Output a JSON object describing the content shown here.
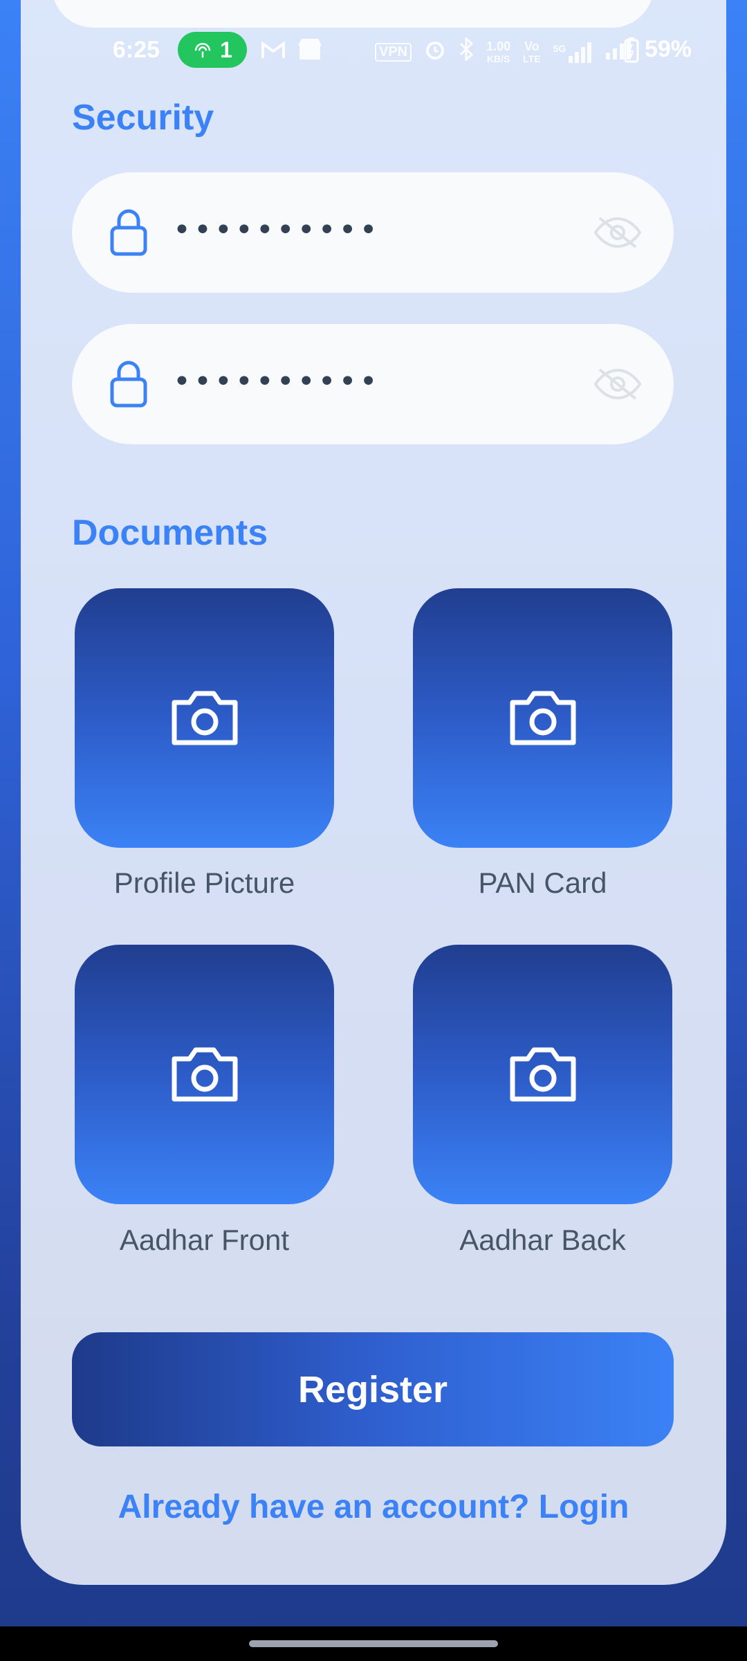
{
  "status_bar": {
    "time": "6:25",
    "hotspot_count": "1",
    "vpn": "VPN",
    "speed_value": "1.00",
    "speed_unit": "KB/S",
    "volte_top": "Vo",
    "volte_bottom": "LTE",
    "network": "5G",
    "battery": "59%"
  },
  "security": {
    "title": "Security",
    "password_value": "••••••••••",
    "confirm_password_value": "••••••••••"
  },
  "documents": {
    "title": "Documents",
    "items": [
      {
        "label": "Profile Picture"
      },
      {
        "label": "PAN Card"
      },
      {
        "label": "Aadhar Front"
      },
      {
        "label": "Aadhar Back"
      }
    ]
  },
  "actions": {
    "register_label": "Register",
    "login_link": "Already have an account? Login"
  },
  "colors": {
    "accent": "#3b82f6",
    "dark_blue": "#1e3a8a",
    "status_green": "#22c55e"
  },
  "icons": [
    "lock-icon",
    "eye-off-icon",
    "camera-icon"
  ]
}
